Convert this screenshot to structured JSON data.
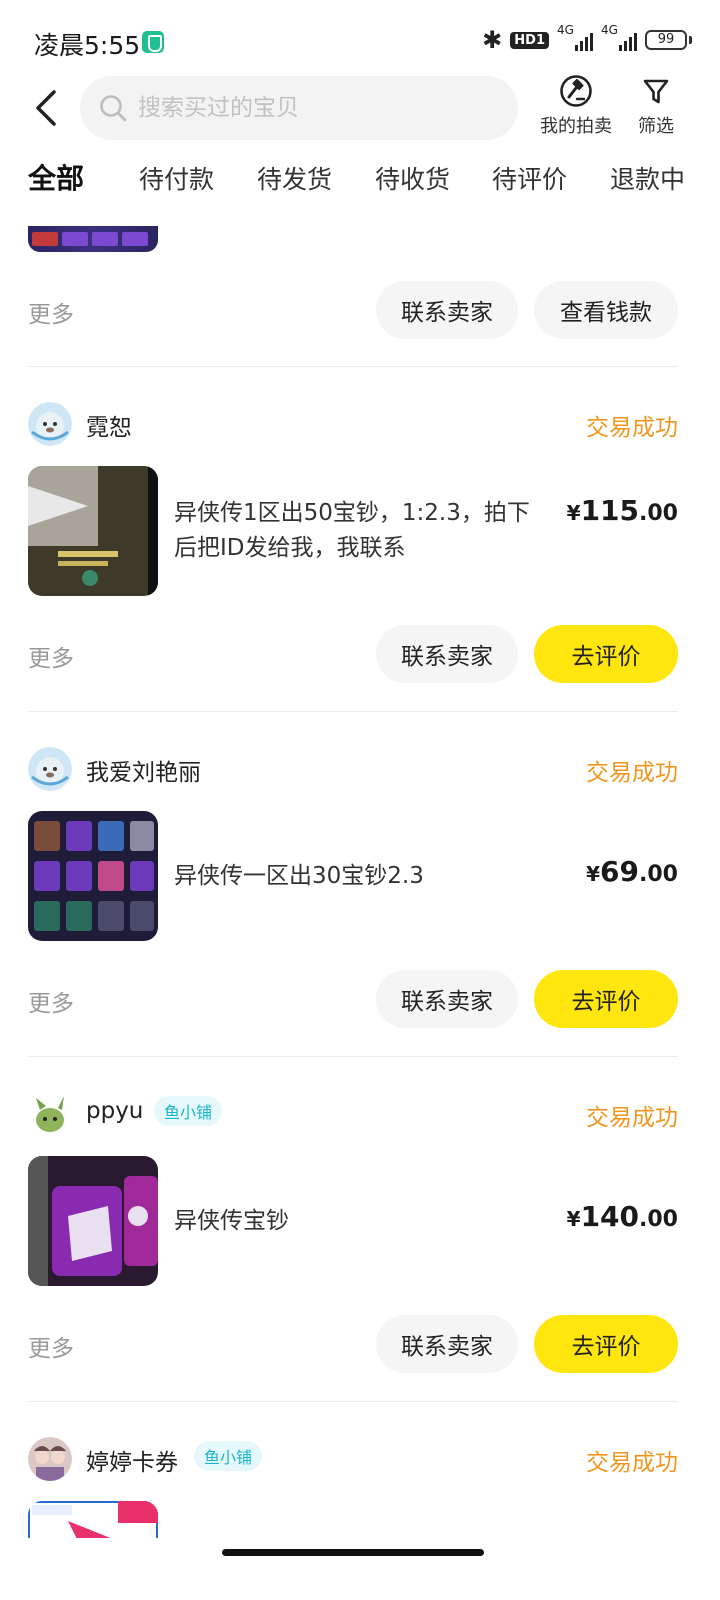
{
  "status_bar": {
    "time": "凌晨5:55",
    "hd": "HD1",
    "net1": "4G",
    "net2": "4G",
    "battery": "99"
  },
  "header": {
    "search_placeholder": "搜索买过的宝贝",
    "auction_label": "我的拍卖",
    "filter_label": "筛选"
  },
  "tabs": [
    "全部",
    "待付款",
    "待发货",
    "待收货",
    "待评价",
    "退款中"
  ],
  "top_actions": {
    "more": "更多",
    "contact": "联系卖家",
    "second": "查看钱款"
  },
  "orders": [
    {
      "seller": "霓恕",
      "badge": "",
      "status": "交易成功",
      "title_line1": "异侠传1区出50宝钞，1:2.3，拍下",
      "title_line2": "后把ID发给我，我联系",
      "price_cur": "¥",
      "price_int": "115",
      "price_dec": ".00",
      "more": "更多",
      "contact": "联系卖家",
      "review": "去评价"
    },
    {
      "seller": "我爱刘艳丽",
      "badge": "",
      "status": "交易成功",
      "title_line1": "异侠传一区出30宝钞2.3",
      "title_line2": "",
      "price_cur": "¥",
      "price_int": "69",
      "price_dec": ".00",
      "more": "更多",
      "contact": "联系卖家",
      "review": "去评价"
    },
    {
      "seller": "ppyu",
      "badge": "鱼小铺",
      "status": "交易成功",
      "title_line1": "异侠传宝钞",
      "title_line2": "",
      "price_cur": "¥",
      "price_int": "140",
      "price_dec": ".00",
      "more": "更多",
      "contact": "联系卖家",
      "review": "去评价"
    },
    {
      "seller": "婷婷卡券",
      "badge": "鱼小铺",
      "status": "交易成功"
    }
  ],
  "colors": {
    "accent_yellow": "#ffe60f",
    "status_orange": "#f0961e",
    "badge_cyan": "#19b6c9"
  }
}
